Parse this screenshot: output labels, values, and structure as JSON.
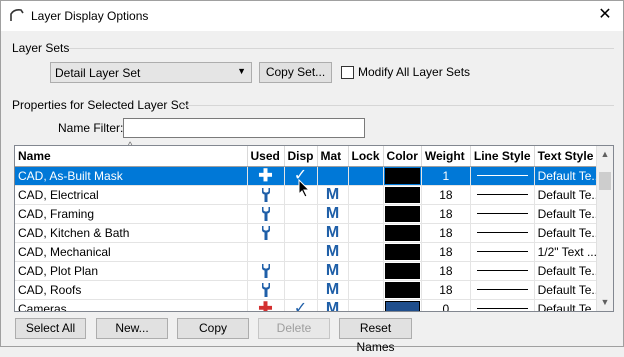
{
  "window": {
    "title": "Layer Display Options"
  },
  "layer_sets": {
    "section_label": "Layer Sets",
    "selected_set": "Detail Layer Set",
    "copy_set_label": "Copy Set...",
    "modify_all_label": "Modify All Layer Sets",
    "modify_all_checked": false
  },
  "properties": {
    "section_label": "Properties for Selected Layer Set",
    "name_filter_label": "Name Filter:",
    "name_filter_value": ""
  },
  "grid": {
    "columns": [
      "Name",
      "Used",
      "Disp",
      "Mat",
      "Lock",
      "Color",
      "Weight",
      "Line Style",
      "Text Style"
    ],
    "rows": [
      {
        "name": "CAD, As-Built Mask",
        "used": "plus-white",
        "disp": true,
        "mat": false,
        "lock": false,
        "color": "#000000",
        "weight": "1",
        "line_style": "solid",
        "text_style": "Default Te...",
        "selected": true
      },
      {
        "name": "CAD, Electrical",
        "used": "wrench",
        "disp": false,
        "mat": true,
        "lock": false,
        "color": "#000000",
        "weight": "18",
        "line_style": "solid",
        "text_style": "Default Te..."
      },
      {
        "name": "CAD, Framing",
        "used": "wrench",
        "disp": false,
        "mat": true,
        "lock": false,
        "color": "#000000",
        "weight": "18",
        "line_style": "solid",
        "text_style": "Default Te..."
      },
      {
        "name": "CAD, Kitchen & Bath",
        "used": "wrench",
        "disp": false,
        "mat": true,
        "lock": false,
        "color": "#000000",
        "weight": "18",
        "line_style": "solid",
        "text_style": "Default Te..."
      },
      {
        "name": "CAD, Mechanical",
        "used": "",
        "disp": false,
        "mat": true,
        "lock": false,
        "color": "#000000",
        "weight": "18",
        "line_style": "solid",
        "text_style": "1/2\" Text ..."
      },
      {
        "name": "CAD, Plot Plan",
        "used": "wrench",
        "disp": false,
        "mat": true,
        "lock": false,
        "color": "#000000",
        "weight": "18",
        "line_style": "solid",
        "text_style": "Default Te..."
      },
      {
        "name": "CAD, Roofs",
        "used": "wrench",
        "disp": false,
        "mat": true,
        "lock": false,
        "color": "#000000",
        "weight": "18",
        "line_style": "solid",
        "text_style": "Default Te..."
      },
      {
        "name": "Cameras",
        "used": "plus-red",
        "disp": true,
        "mat": true,
        "lock": false,
        "color": "#1f4e8c",
        "weight": "0",
        "line_style": "solid",
        "text_style": "Default Te..."
      }
    ]
  },
  "buttons": {
    "select_all": "Select All",
    "new": "New...",
    "copy": "Copy",
    "delete": "Delete",
    "reset_names": "Reset Names"
  },
  "colors": {
    "selection": "#0078d7",
    "icon_blue": "#1f5fa8",
    "icon_red": "#d32f2f"
  }
}
